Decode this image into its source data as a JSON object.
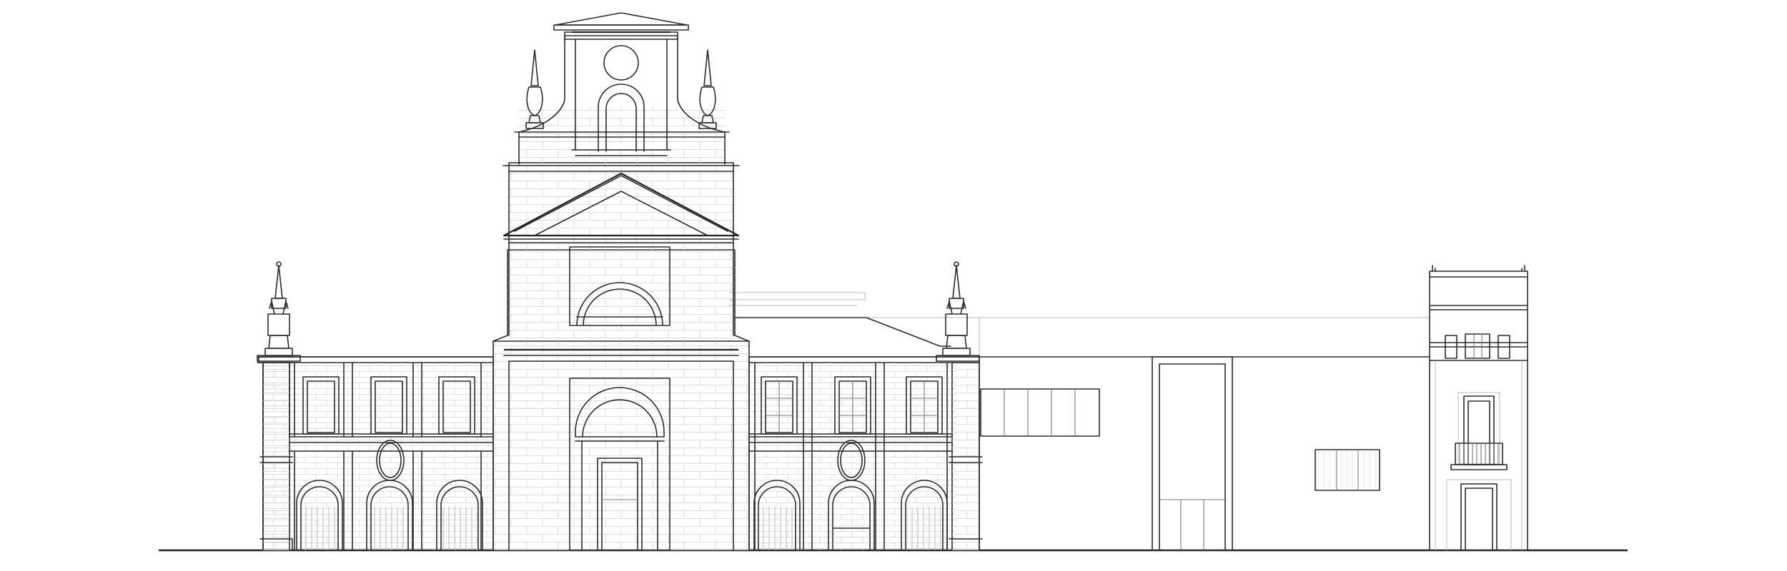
{
  "drawing": {
    "kind": "architectural-elevation",
    "line_color": "#2b2b2b",
    "background": "#ffffff"
  }
}
